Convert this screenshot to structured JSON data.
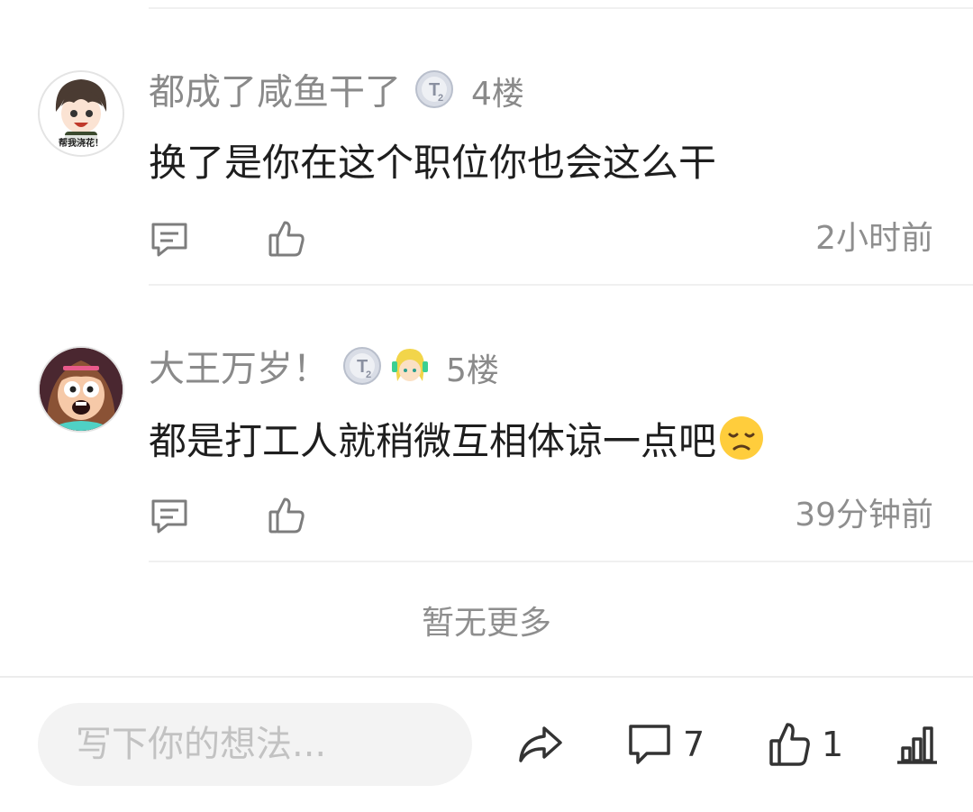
{
  "comments": [
    {
      "username": "都成了咸鱼干了",
      "badge_text": "T2",
      "floor": "4楼",
      "avatar_caption": "帮我浇花！",
      "content": "换了是你在这个职位你也会这么干",
      "time": "2小时前"
    },
    {
      "username": "大王万岁！",
      "badge_text": "T2",
      "floor": "5楼",
      "content": "都是打工人就稍微互相体谅一点吧",
      "content_emoji": "disappointed-face-emoji",
      "time": "39分钟前"
    }
  ],
  "no_more_text": "暂无更多",
  "bottom_bar": {
    "input_placeholder": "写下你的想法...",
    "comment_count": "7",
    "like_count": "1"
  },
  "colors": {
    "secondary_text": "#8a8a8a",
    "divider": "#f0f0f0",
    "input_bg": "#f3f3f3",
    "emoji_yellow": "#ffcd3c"
  }
}
